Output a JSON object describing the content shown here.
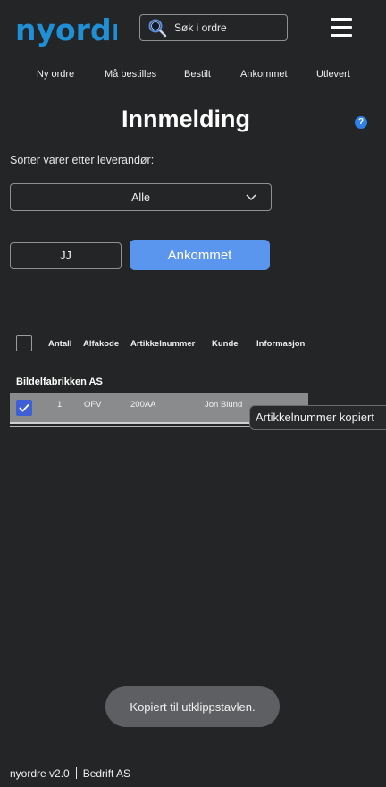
{
  "header": {
    "logo_text": "nyordre",
    "search_placeholder": "Søk i ordre",
    "search_icon": "search-icon",
    "menu_icon": "hamburger-menu-icon"
  },
  "nav": {
    "items": [
      "Ny ordre",
      "Må bestilles",
      "Bestilt",
      "Ankommet",
      "Utlevert"
    ]
  },
  "page": {
    "title": "Innmelding",
    "help_label": "?"
  },
  "filter": {
    "label": "Sorter varer etter leverandør:",
    "selected": "Alle"
  },
  "actions": {
    "initials_value": "JJ",
    "arrived_button": "Ankommet"
  },
  "table": {
    "headers": [
      "Antall",
      "Alfakode",
      "Artikkelnummer",
      "Kunde",
      "Informasjon"
    ],
    "groups": [
      {
        "supplier": "Bildelfabrikken AS",
        "rows": [
          {
            "checked": true,
            "antall": "1",
            "alfakode": "OFV",
            "artikkelnummer": "200AA",
            "kunde": "Jon Blund",
            "informasjon": ""
          }
        ]
      }
    ]
  },
  "tooltip": {
    "text": "Artikkelnummer kopiert"
  },
  "toast": {
    "text": "Kopiert til utklippstavlen."
  },
  "footer": {
    "app_version": "nyordre v2.0",
    "company": "Bedrift AS"
  },
  "colors": {
    "background": "#242526",
    "brand": "#1f8fd6",
    "primary_button": "#5b96ee",
    "checkbox_checked": "#3e5fd6",
    "help_icon": "#2f80e8"
  }
}
